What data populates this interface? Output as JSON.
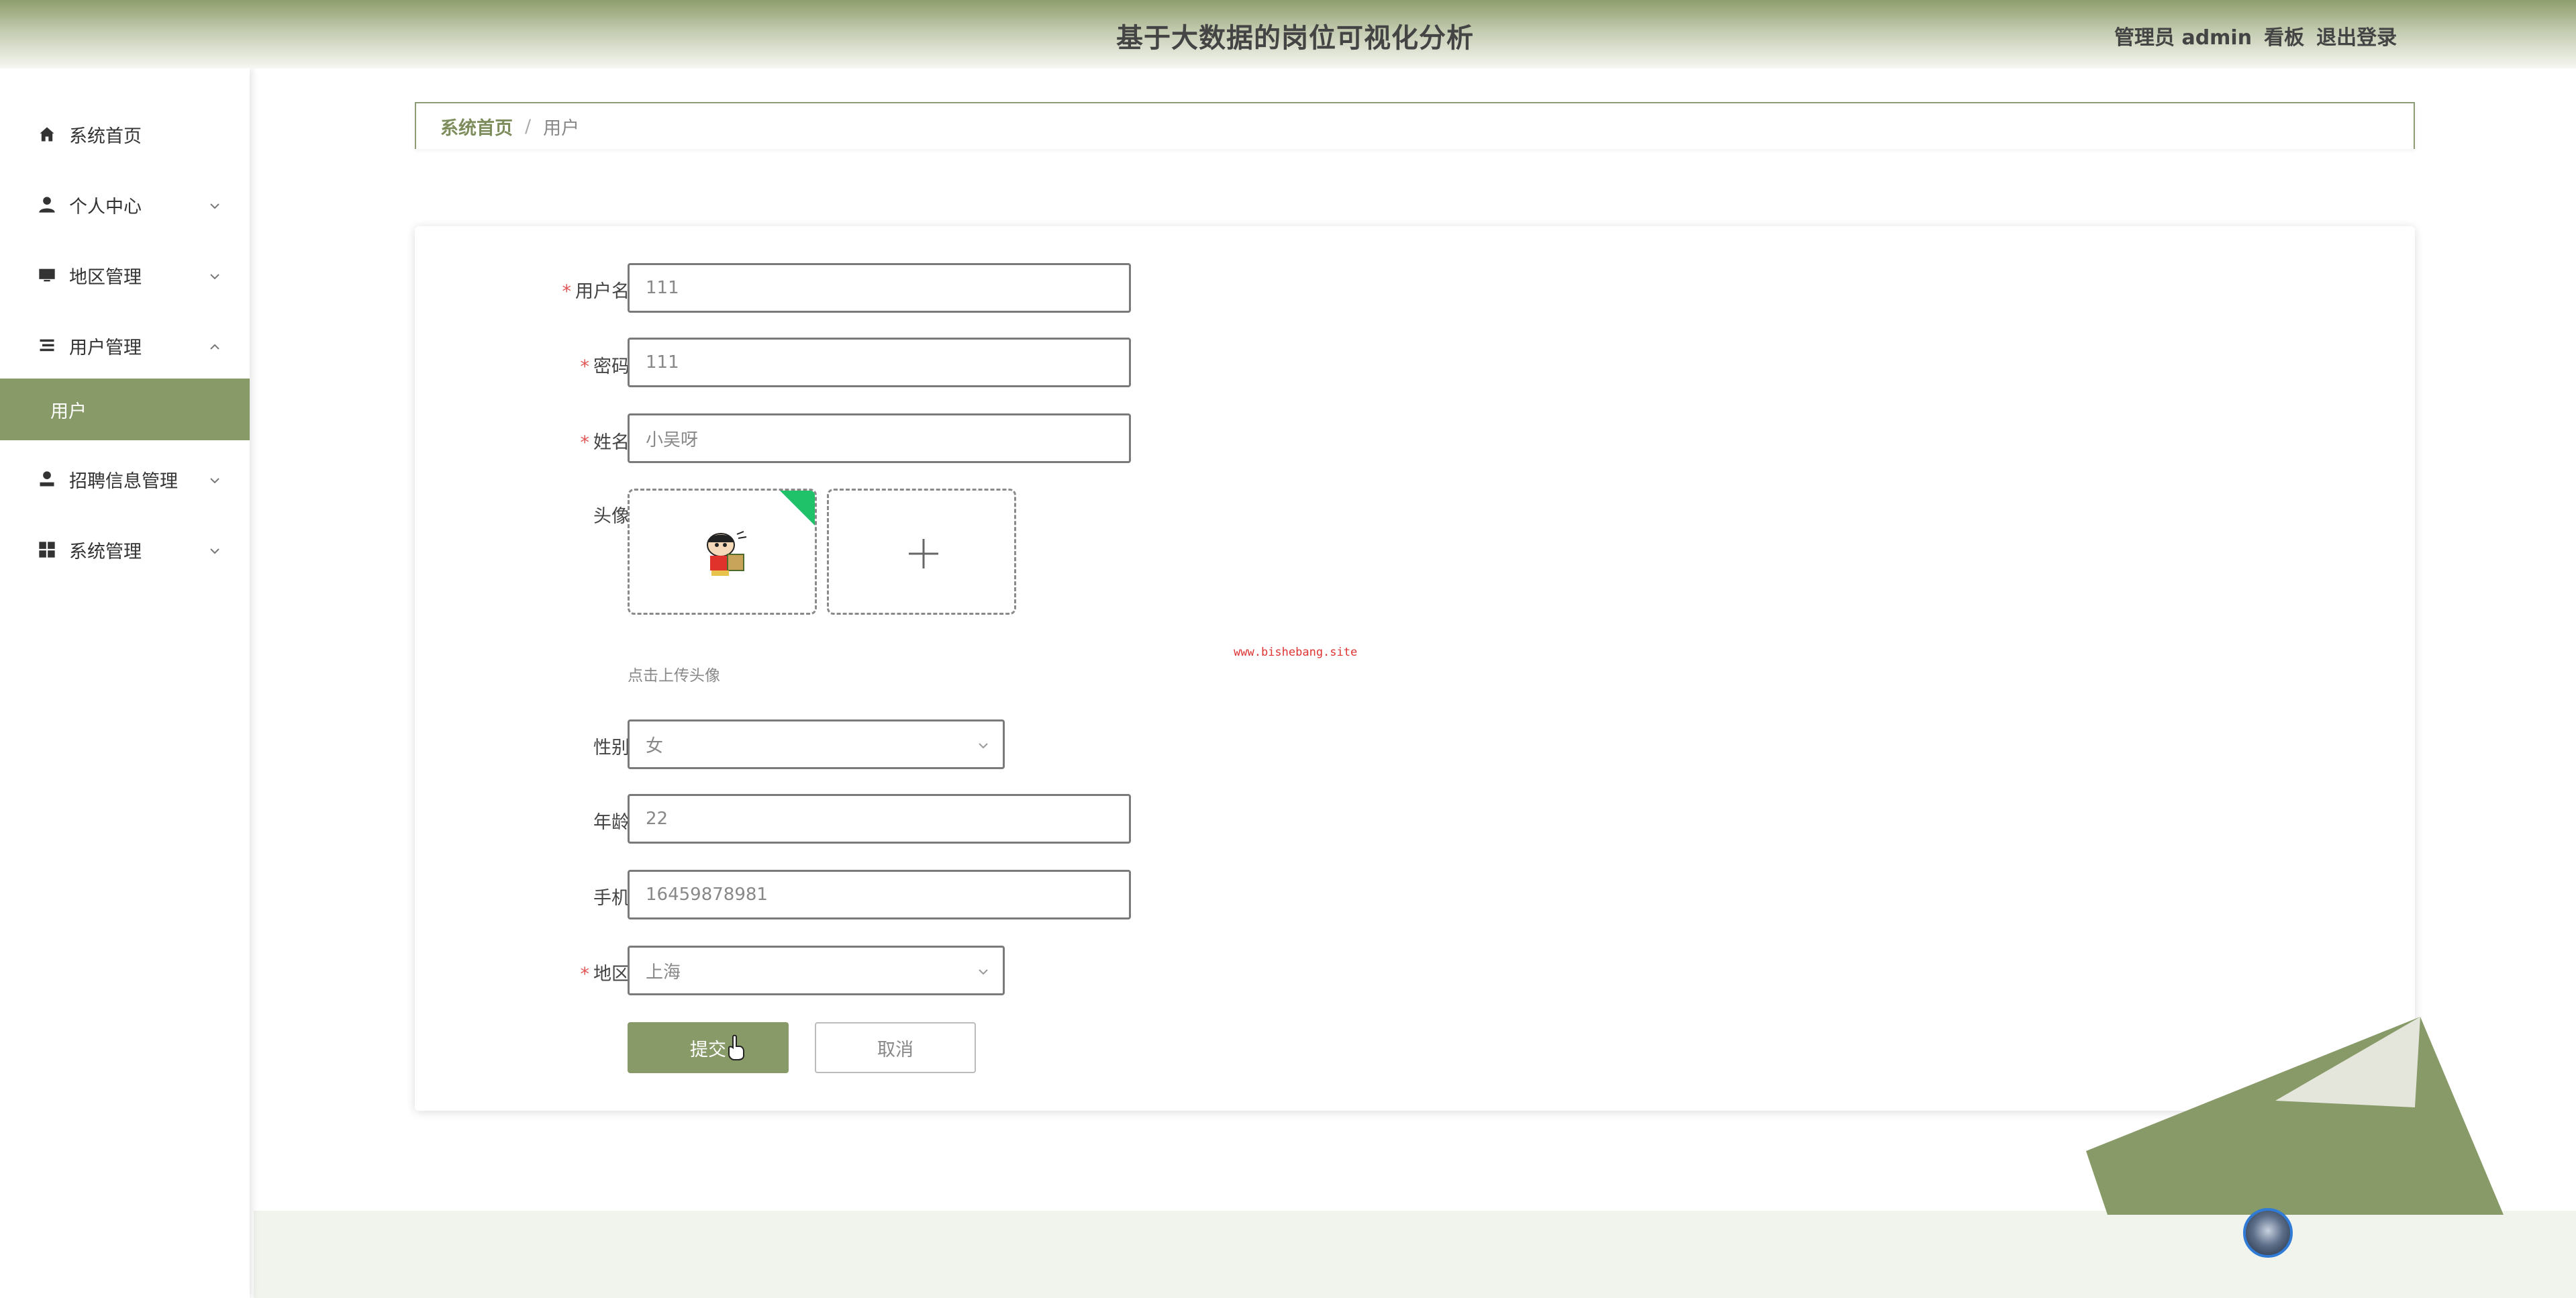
{
  "header": {
    "title": "基于大数据的岗位可视化分析",
    "user_label": "管理员 admin",
    "board_label": "看板",
    "logout_label": "退出登录"
  },
  "sidebar": {
    "items": [
      {
        "label": "系统首页",
        "icon": "home-icon"
      },
      {
        "label": "个人中心",
        "icon": "user-icon"
      },
      {
        "label": "地区管理",
        "icon": "monitor-icon"
      },
      {
        "label": "用户管理",
        "icon": "list-icon"
      },
      {
        "label": "招聘信息管理",
        "icon": "recruit-icon"
      },
      {
        "label": "系统管理",
        "icon": "grid-icon"
      }
    ],
    "submenu": {
      "label": "用户"
    }
  },
  "breadcrumb": {
    "home": "系统首页",
    "separator": "/",
    "current": "用户"
  },
  "form": {
    "username": {
      "label": "用户名",
      "value": "111"
    },
    "password": {
      "label": "密码",
      "value": "111"
    },
    "name": {
      "label": "姓名",
      "value": "小吴呀"
    },
    "avatar": {
      "label": "头像",
      "tip": "点击上传头像"
    },
    "gender": {
      "label": "性别",
      "value": "女"
    },
    "age": {
      "label": "年龄",
      "value": "22"
    },
    "phone": {
      "label": "手机",
      "value": "16459878981"
    },
    "region": {
      "label": "地区",
      "value": "上海"
    },
    "required_mark": "*",
    "submit_label": "提交",
    "cancel_label": "取消"
  },
  "watermark": "www.bishebang.site",
  "colors": {
    "accent": "#889a68",
    "breadcrumb_home": "#7d8c5b",
    "required": "#e05555",
    "upload_badge": "#1fc269"
  }
}
